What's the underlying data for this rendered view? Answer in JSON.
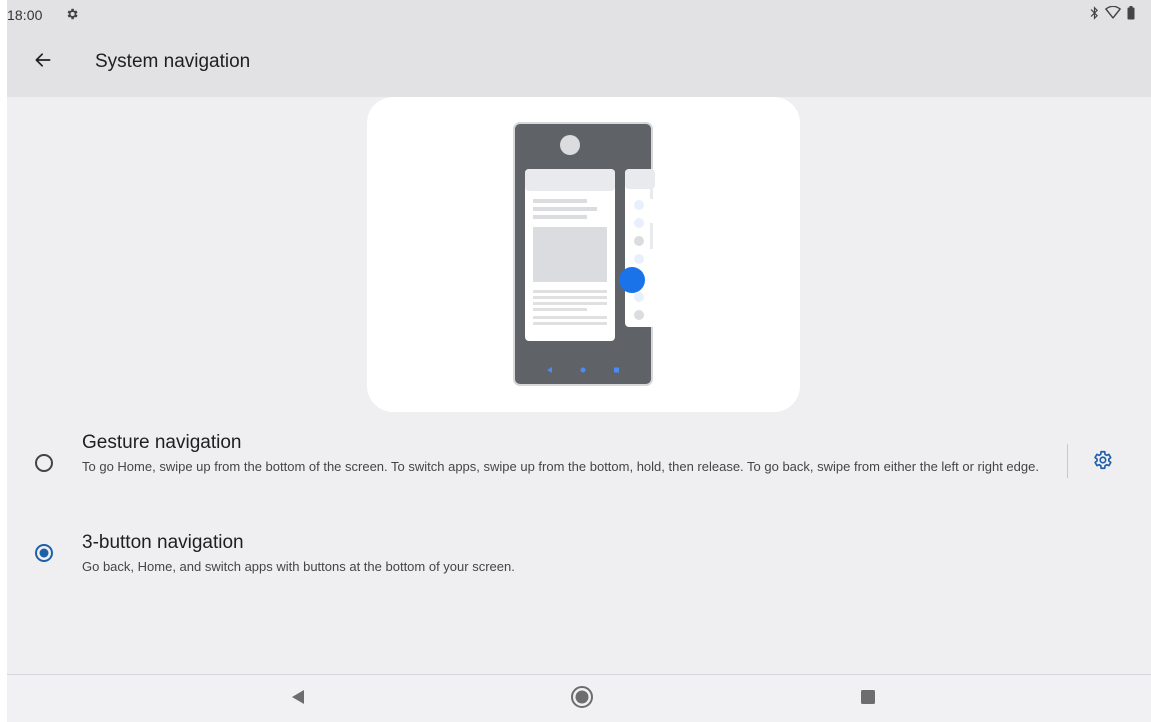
{
  "status_bar": {
    "time": "18:00",
    "icons": [
      "settings-gear-icon",
      "bluetooth-icon",
      "wifi-icon",
      "battery-icon"
    ]
  },
  "toolbar": {
    "back_icon": "arrow-back-icon",
    "title": "System navigation"
  },
  "illustration": {
    "description_icon": "gesture-navigation-illustration"
  },
  "options": [
    {
      "title": "Gesture navigation",
      "summary": "To go Home, swipe up from the bottom of the screen. To switch apps, swipe up from the bottom, hold, then release. To go back, swipe from either the left or right edge.",
      "selected": false,
      "settings_icon": "gear-settings-icon"
    },
    {
      "title": "3-button navigation",
      "summary": "Go back, Home, and switch apps with buttons at the bottom of your screen.",
      "selected": true
    }
  ],
  "nav_bar": {
    "icons": [
      "nav-back-icon",
      "nav-home-icon",
      "nav-recents-icon"
    ]
  },
  "colors": {
    "accent": "#1f5fa8",
    "background": "#efeff2",
    "header": "#e2e2e5",
    "illustration_blue": "#1a73e8"
  }
}
